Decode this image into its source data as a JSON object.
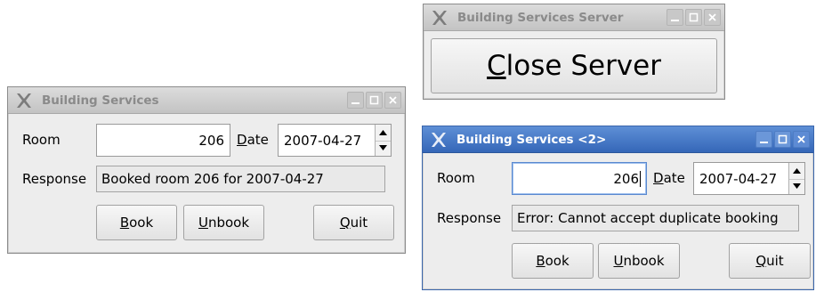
{
  "server_window": {
    "title": "Building Services Server",
    "close_button": {
      "mnemonic": "C",
      "rest": "lose Server"
    }
  },
  "client_window_1": {
    "title": "Building Services",
    "room_label": "Room",
    "room_value": "206",
    "date_label_mnemonic": "D",
    "date_label_rest": "ate",
    "date_value": "2007-04-27",
    "response_label": "Response",
    "response_value": "Booked room 206 for 2007-04-27",
    "book_mnemonic": "B",
    "book_rest": "ook",
    "unbook_mnemonic": "U",
    "unbook_rest": "nbook",
    "quit_mnemonic": "Q",
    "quit_rest": "uit"
  },
  "client_window_2": {
    "title": "Building Services <2>",
    "room_label": "Room",
    "room_value": "206",
    "date_label_mnemonic": "D",
    "date_label_rest": "ate",
    "date_value": "2007-04-27",
    "response_label": "Response",
    "response_value": "Error: Cannot accept duplicate booking",
    "book_mnemonic": "B",
    "book_rest": "ook",
    "unbook_mnemonic": "U",
    "unbook_rest": "nbook",
    "quit_mnemonic": "Q",
    "quit_rest": "uit"
  },
  "icons": {
    "app": "x-logo-icon",
    "minimize": "minimize-icon",
    "maximize": "maximize-icon",
    "close": "close-icon",
    "spin_up": "chevron-up-icon",
    "spin_down": "chevron-down-icon"
  },
  "colors": {
    "active_titlebar": "#3567b8",
    "inactive_titlebar": "#c3c3c3",
    "window_bg": "#ededed"
  }
}
